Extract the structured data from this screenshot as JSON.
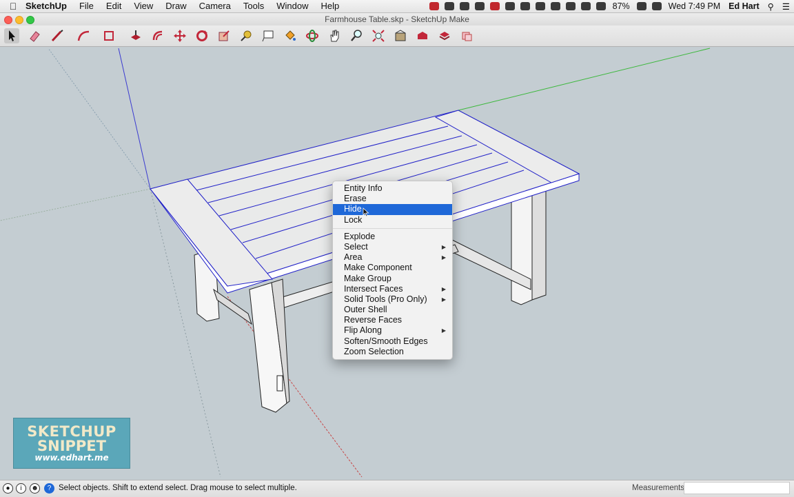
{
  "menubar": {
    "app_name": "SketchUp",
    "items": [
      "File",
      "Edit",
      "View",
      "Draw",
      "Camera",
      "Tools",
      "Window",
      "Help"
    ],
    "battery": "87%",
    "clock": "Wed 7:49 PM",
    "user": "Ed Hart"
  },
  "window": {
    "title": "Farmhouse Table.skp - SketchUp Make"
  },
  "toolbar": {
    "tools": [
      "select-tool-icon",
      "eraser-tool-icon",
      "line-tool-icon",
      "arc-tool-icon",
      "rectangle-tool-icon",
      "push-pull-tool-icon",
      "offset-tool-icon",
      "move-tool-icon",
      "rotate-tool-icon",
      "scale-tool-icon",
      "tape-measure-tool-icon",
      "text-tool-icon",
      "paint-bucket-tool-icon",
      "orbit-tool-icon",
      "pan-tool-icon",
      "zoom-tool-icon",
      "zoom-extents-tool-icon",
      "warehouse-icon",
      "extension-warehouse-icon",
      "layout-icon",
      "ruby-icon",
      "style-icon"
    ]
  },
  "context_menu": {
    "group1": [
      "Entity Info",
      "Erase",
      "Hide",
      "Lock"
    ],
    "selected": "Hide",
    "group2": [
      {
        "label": "Explode",
        "submenu": false
      },
      {
        "label": "Select",
        "submenu": true
      },
      {
        "label": "Area",
        "submenu": true
      },
      {
        "label": "Make Component",
        "submenu": false
      },
      {
        "label": "Make Group",
        "submenu": false
      },
      {
        "label": "Intersect Faces",
        "submenu": true
      },
      {
        "label": "Solid Tools (Pro Only)",
        "submenu": true
      },
      {
        "label": "Outer Shell",
        "submenu": false
      },
      {
        "label": "Reverse Faces",
        "submenu": false
      },
      {
        "label": "Flip Along",
        "submenu": true
      },
      {
        "label": "Soften/Smooth Edges",
        "submenu": false
      },
      {
        "label": "Zoom Selection",
        "submenu": false
      }
    ]
  },
  "statusbar": {
    "text": "Select objects. Shift to extend select. Drag mouse to select multiple.",
    "measurements_label": "Measurements",
    "measurements_value": ""
  },
  "watermark": {
    "line1": "SKETCHUP",
    "line2": "SNIPPET",
    "line3": "www.edhart.me"
  },
  "colors": {
    "selection_blue": "#1f68d8",
    "viewport_bg": "#c4cdd2",
    "selected_edge": "#2020c8",
    "green_axis": "#3cb83c",
    "red_axis": "#c84646"
  }
}
